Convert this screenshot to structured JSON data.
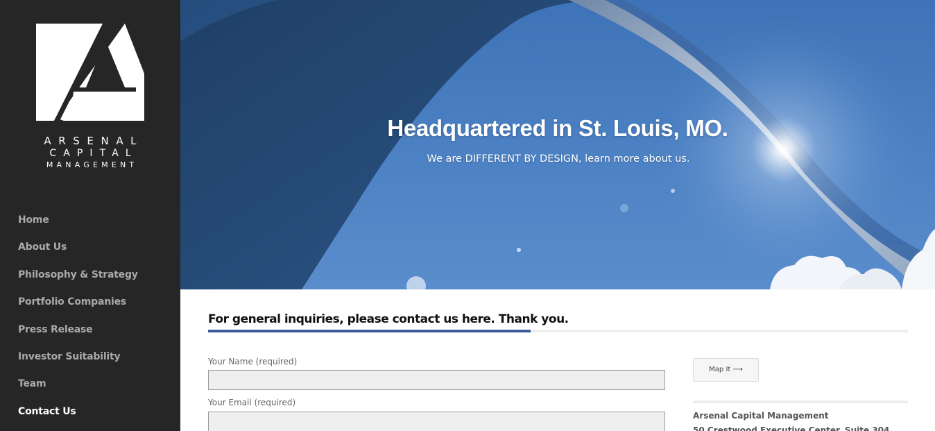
{
  "logo": {
    "line1": "ARSENAL",
    "line2": "CAPITAL",
    "line3": "MANAGEMENT",
    "icon": "arsenal-a-logo"
  },
  "nav": {
    "items": [
      {
        "label": "Home"
      },
      {
        "label": "About Us"
      },
      {
        "label": "Philosophy & Strategy"
      },
      {
        "label": "Portfolio Companies"
      },
      {
        "label": "Press Release"
      },
      {
        "label": "Investor Suitability"
      },
      {
        "label": "Team"
      },
      {
        "label": "Contact Us"
      }
    ],
    "active": "Contact Us"
  },
  "hero": {
    "title": "Headquartered in St. Louis, MO.",
    "subtitle": "We are DIFFERENT BY DESIGN, learn more about us."
  },
  "contact": {
    "heading": "For general inquiries, please contact us here. Thank you.",
    "name_label": "Your Name (required)",
    "name_value": "",
    "email_label": "Your Email (required)",
    "email_value": "",
    "map_button": "Map It ⟶",
    "address_name": "Arsenal Capital Management",
    "address_line": "50 Crestwood Executive Center, Suite 304"
  },
  "colors": {
    "sidebar_bg": "#262626",
    "nav_text": "#a9a9a9",
    "nav_active": "#ffffff",
    "accent": "#3a5a9a",
    "sky": "#4b80c3"
  }
}
